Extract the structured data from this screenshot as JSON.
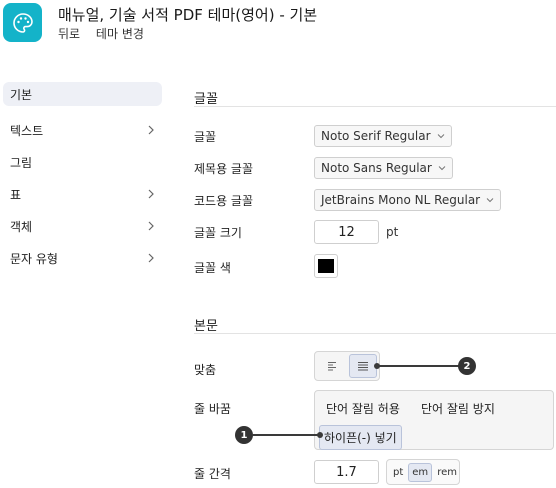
{
  "header": {
    "title": "매뉴얼, 기술 서적 PDF 테마(영어) - 기본",
    "back_link": "뒤로",
    "change_theme_link": "테마 변경"
  },
  "sidebar": {
    "items": [
      {
        "label": "기본",
        "has_chevron": false,
        "active": true
      },
      {
        "label": "텍스트",
        "has_chevron": true,
        "active": false
      },
      {
        "label": "그림",
        "has_chevron": false,
        "active": false
      },
      {
        "label": "표",
        "has_chevron": true,
        "active": false
      },
      {
        "label": "객체",
        "has_chevron": true,
        "active": false
      },
      {
        "label": "문자 유형",
        "has_chevron": true,
        "active": false
      }
    ]
  },
  "font_section": {
    "title": "글꼴",
    "font_label": "글꼴",
    "font_value": "Noto Serif Regular",
    "heading_font_label": "제목용 글꼴",
    "heading_font_value": "Noto Sans Regular",
    "code_font_label": "코드용 글꼴",
    "code_font_value": "JetBrains Mono NL Regular",
    "font_size_label": "글꼴 크기",
    "font_size_value": "12",
    "font_size_unit": "pt",
    "font_color_label": "글꼴 색",
    "font_color": "#000000"
  },
  "body_section": {
    "title": "본문",
    "align_label": "맞춤",
    "wrap_label": "줄 바꿈",
    "wrap_allow": "단어 잘림 허용",
    "wrap_prevent": "단어 잘림 방지",
    "wrap_hyphen": "하이픈(-) 넣기",
    "line_spacing_label": "줄 간격",
    "line_spacing_value": "1.7",
    "units": [
      "pt",
      "em",
      "rem"
    ],
    "selected_unit": "em"
  },
  "callouts": {
    "one": "1",
    "two": "2"
  },
  "colors": {
    "app_icon": "#14b3c9",
    "selected_bg": "#e4e8f2",
    "sidebar_active_bg": "#eef0f6"
  }
}
